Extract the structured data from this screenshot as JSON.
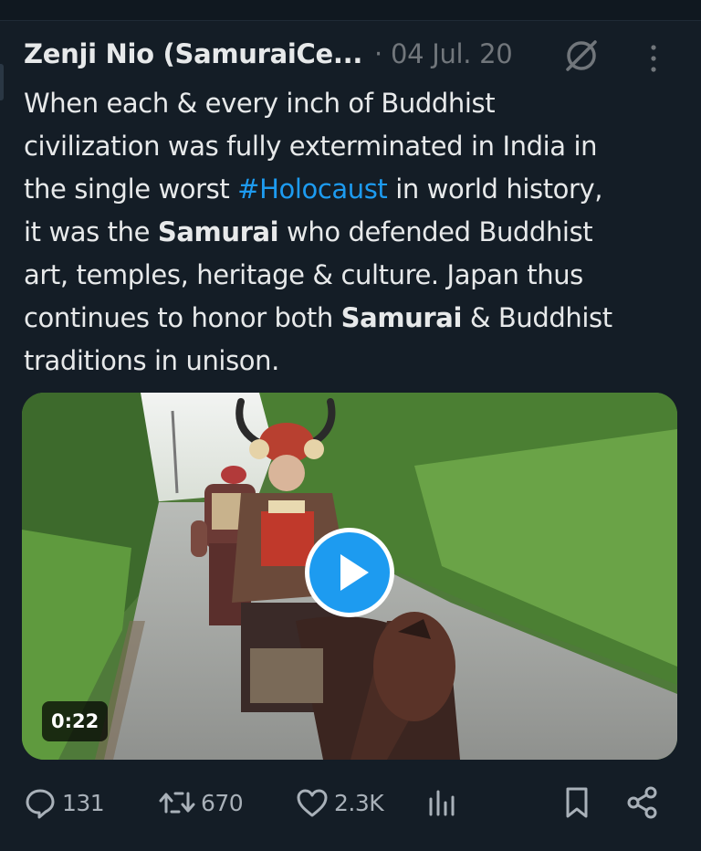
{
  "post": {
    "author_name": "Zenji Nio (SamuraiCe...",
    "separator": "·",
    "date": "04 Jul. 20",
    "text_lines": [
      {
        "before": "When each & every inch of Buddhist"
      },
      {
        "before": "civilization was fully exterminated in India in"
      },
      {
        "before": "the single worst ",
        "hashtag": "#Holocaust",
        "after": " in world history,"
      },
      {
        "before": "it was the ",
        "bold": "Samurai",
        "after": " who defended Buddhist"
      },
      {
        "before": "art, temples, heritage & culture. Japan thus"
      },
      {
        "before": "continues to honor both ",
        "bold": "Samurai",
        "after": " & Buddhist"
      },
      {
        "before": "traditions in unison."
      }
    ],
    "video": {
      "duration": "0:22"
    },
    "metrics": {
      "replies": "131",
      "reposts": "670",
      "likes": "2.3K"
    }
  },
  "icons": {
    "grok": "grok-icon",
    "more": "more-icon",
    "play": "play-icon",
    "reply": "reply-icon",
    "repost": "repost-icon",
    "like": "heart-icon",
    "views": "analytics-icon",
    "bookmark": "bookmark-icon",
    "share": "share-icon"
  },
  "colors": {
    "background": "#141d26",
    "text": "#e7e9ea",
    "muted": "#71767b",
    "link": "#1d9bf0"
  }
}
